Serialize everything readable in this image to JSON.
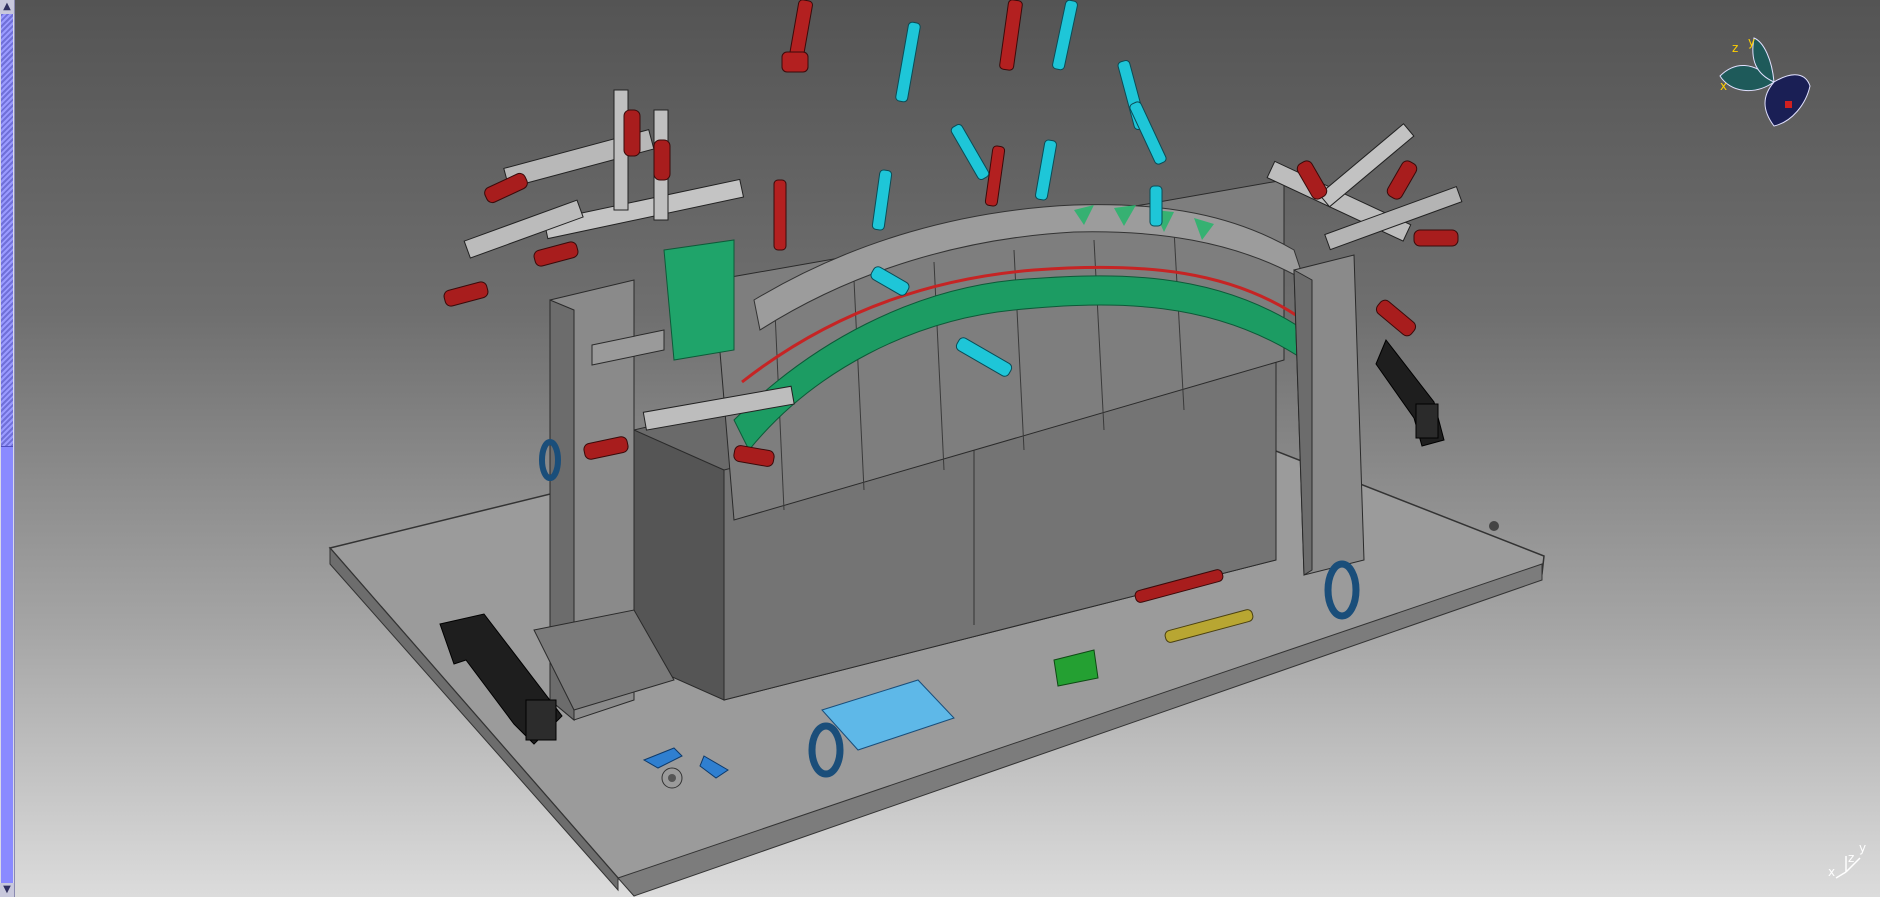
{
  "window": {
    "title": ""
  },
  "scrollbar": {
    "up_arrow": "▲",
    "down_arrow": "▼"
  },
  "compass": {
    "x_label": "x",
    "y_label": "y",
    "z_label": "z"
  },
  "mini_axis": {
    "x_label": "x",
    "y_label": "y",
    "z_label": "z"
  },
  "colors": {
    "background_top": "#545454",
    "background_bottom": "#dcdcdc",
    "baseplate": "#9a9a9a",
    "fixture_body": "#888888",
    "green_panel": "#1fa46a",
    "red_pins": "#b32020",
    "cyan_pins": "#1ec6d8",
    "blue_accents": "#4aaee8"
  }
}
